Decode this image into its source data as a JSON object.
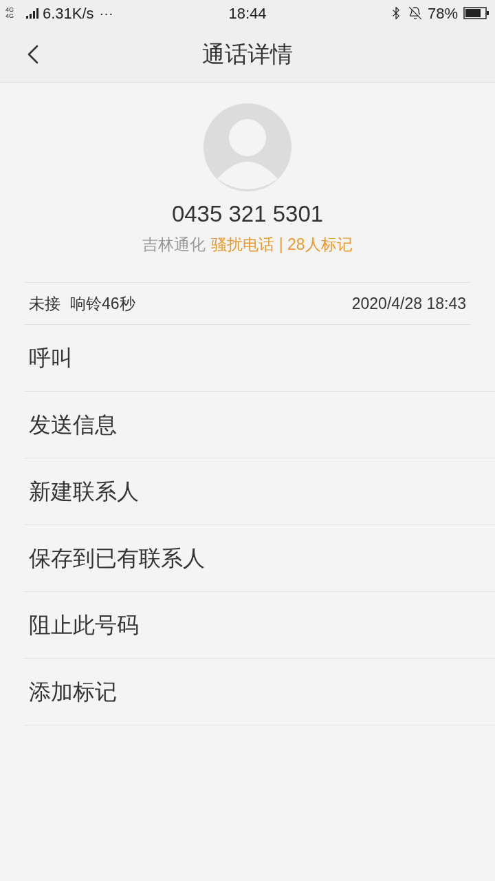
{
  "status_bar": {
    "network": "4G 4G",
    "speed": "6.31K/s",
    "more": "···",
    "time": "18:44",
    "battery": "78%"
  },
  "header": {
    "title": "通话详情"
  },
  "contact": {
    "number": "0435 321 5301",
    "location": "吉林通化",
    "tag": "骚扰电话 | 28人标记"
  },
  "call": {
    "status": "未接",
    "ring": "响铃46秒",
    "datetime": "2020/4/28 18:43"
  },
  "actions": [
    "呼叫",
    "发送信息",
    "新建联系人",
    "保存到已有联系人",
    "阻止此号码",
    "添加标记"
  ]
}
